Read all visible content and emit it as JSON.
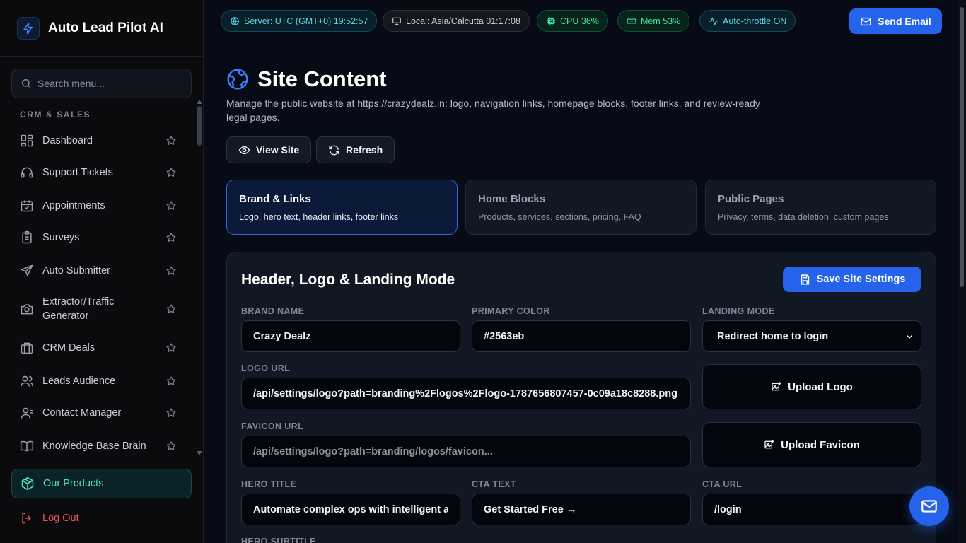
{
  "app": {
    "name": "Auto Lead Pilot AI"
  },
  "sidebar": {
    "search_placeholder": "Search menu...",
    "section_label": "CRM & SALES",
    "items": [
      {
        "label": "Dashboard",
        "icon": "dashboard-icon"
      },
      {
        "label": "Support Tickets",
        "icon": "headset-icon"
      },
      {
        "label": "Appointments",
        "icon": "calendar-icon"
      },
      {
        "label": "Surveys",
        "icon": "clipboard-icon"
      },
      {
        "label": "Auto Submitter",
        "icon": "send-icon"
      },
      {
        "label": "Extractor/Traffic Generator",
        "icon": "camera-icon"
      },
      {
        "label": "CRM Deals",
        "icon": "briefcase-icon"
      },
      {
        "label": "Leads Audience",
        "icon": "users-icon"
      },
      {
        "label": "Contact Manager",
        "icon": "contacts-icon"
      },
      {
        "label": "Knowledge Base Brain",
        "icon": "book-icon"
      }
    ],
    "our_products": "Our Products",
    "log_out": "Log Out"
  },
  "topbar": {
    "server": "Server: UTC (GMT+0) 19:52:57",
    "local": "Local: Asia/Calcutta 01:17:08",
    "cpu": "CPU 36%",
    "mem": "Mem 53%",
    "throttle": "Auto-throttle ON",
    "send_email": "Send Email"
  },
  "page": {
    "title": "Site Content",
    "subtitle": "Manage the public website at https://crazydealz.in: logo, navigation links, homepage blocks, footer links, and review-ready legal pages.",
    "view_site": "View Site",
    "refresh": "Refresh"
  },
  "tabs": [
    {
      "title": "Brand & Links",
      "desc": "Logo, hero text, header links, footer links",
      "active": true
    },
    {
      "title": "Home Blocks",
      "desc": "Products, services, sections, pricing, FAQ",
      "active": false
    },
    {
      "title": "Public Pages",
      "desc": "Privacy, terms, data deletion, custom pages",
      "active": false
    }
  ],
  "panel": {
    "title": "Header, Logo & Landing Mode",
    "save_label": "Save Site Settings",
    "brand_name_label": "BRAND NAME",
    "brand_name_value": "Crazy Dealz",
    "primary_color_label": "PRIMARY COLOR",
    "primary_color_value": "#2563eb",
    "landing_mode_label": "LANDING MODE",
    "landing_mode_value": "Redirect home to login",
    "logo_url_label": "LOGO URL",
    "logo_url_value": "/api/settings/logo?path=branding%2Flogos%2Flogo-1787656807457-0c09a18c8288.png",
    "upload_logo": "Upload Logo",
    "favicon_url_label": "FAVICON URL",
    "favicon_url_placeholder": "/api/settings/logo?path=branding/logos/favicon...",
    "upload_favicon": "Upload Favicon",
    "hero_title_label": "HERO TITLE",
    "hero_title_value": "Automate complex ops with intelligent a",
    "cta_text_label": "CTA TEXT",
    "cta_text_value": "Get Started Free →",
    "cta_url_label": "CTA URL",
    "cta_url_value": "/login",
    "hero_subtitle_label": "HERO SUBTITLE"
  }
}
